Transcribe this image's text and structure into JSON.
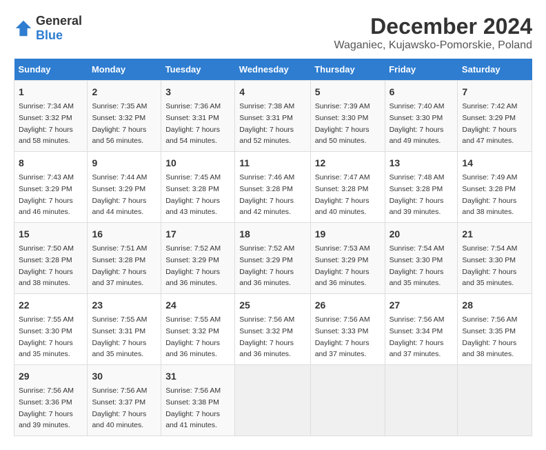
{
  "logo": {
    "general": "General",
    "blue": "Blue"
  },
  "title": "December 2024",
  "subtitle": "Waganiec, Kujawsko-Pomorskie, Poland",
  "days_of_week": [
    "Sunday",
    "Monday",
    "Tuesday",
    "Wednesday",
    "Thursday",
    "Friday",
    "Saturday"
  ],
  "weeks": [
    [
      {
        "day": "1",
        "sunrise": "7:34 AM",
        "sunset": "3:32 PM",
        "daylight": "7 hours and 58 minutes."
      },
      {
        "day": "2",
        "sunrise": "7:35 AM",
        "sunset": "3:32 PM",
        "daylight": "7 hours and 56 minutes."
      },
      {
        "day": "3",
        "sunrise": "7:36 AM",
        "sunset": "3:31 PM",
        "daylight": "7 hours and 54 minutes."
      },
      {
        "day": "4",
        "sunrise": "7:38 AM",
        "sunset": "3:31 PM",
        "daylight": "7 hours and 52 minutes."
      },
      {
        "day": "5",
        "sunrise": "7:39 AM",
        "sunset": "3:30 PM",
        "daylight": "7 hours and 50 minutes."
      },
      {
        "day": "6",
        "sunrise": "7:40 AM",
        "sunset": "3:30 PM",
        "daylight": "7 hours and 49 minutes."
      },
      {
        "day": "7",
        "sunrise": "7:42 AM",
        "sunset": "3:29 PM",
        "daylight": "7 hours and 47 minutes."
      }
    ],
    [
      {
        "day": "8",
        "sunrise": "7:43 AM",
        "sunset": "3:29 PM",
        "daylight": "7 hours and 46 minutes."
      },
      {
        "day": "9",
        "sunrise": "7:44 AM",
        "sunset": "3:29 PM",
        "daylight": "7 hours and 44 minutes."
      },
      {
        "day": "10",
        "sunrise": "7:45 AM",
        "sunset": "3:28 PM",
        "daylight": "7 hours and 43 minutes."
      },
      {
        "day": "11",
        "sunrise": "7:46 AM",
        "sunset": "3:28 PM",
        "daylight": "7 hours and 42 minutes."
      },
      {
        "day": "12",
        "sunrise": "7:47 AM",
        "sunset": "3:28 PM",
        "daylight": "7 hours and 40 minutes."
      },
      {
        "day": "13",
        "sunrise": "7:48 AM",
        "sunset": "3:28 PM",
        "daylight": "7 hours and 39 minutes."
      },
      {
        "day": "14",
        "sunrise": "7:49 AM",
        "sunset": "3:28 PM",
        "daylight": "7 hours and 38 minutes."
      }
    ],
    [
      {
        "day": "15",
        "sunrise": "7:50 AM",
        "sunset": "3:28 PM",
        "daylight": "7 hours and 38 minutes."
      },
      {
        "day": "16",
        "sunrise": "7:51 AM",
        "sunset": "3:28 PM",
        "daylight": "7 hours and 37 minutes."
      },
      {
        "day": "17",
        "sunrise": "7:52 AM",
        "sunset": "3:29 PM",
        "daylight": "7 hours and 36 minutes."
      },
      {
        "day": "18",
        "sunrise": "7:52 AM",
        "sunset": "3:29 PM",
        "daylight": "7 hours and 36 minutes."
      },
      {
        "day": "19",
        "sunrise": "7:53 AM",
        "sunset": "3:29 PM",
        "daylight": "7 hours and 36 minutes."
      },
      {
        "day": "20",
        "sunrise": "7:54 AM",
        "sunset": "3:30 PM",
        "daylight": "7 hours and 35 minutes."
      },
      {
        "day": "21",
        "sunrise": "7:54 AM",
        "sunset": "3:30 PM",
        "daylight": "7 hours and 35 minutes."
      }
    ],
    [
      {
        "day": "22",
        "sunrise": "7:55 AM",
        "sunset": "3:30 PM",
        "daylight": "7 hours and 35 minutes."
      },
      {
        "day": "23",
        "sunrise": "7:55 AM",
        "sunset": "3:31 PM",
        "daylight": "7 hours and 35 minutes."
      },
      {
        "day": "24",
        "sunrise": "7:55 AM",
        "sunset": "3:32 PM",
        "daylight": "7 hours and 36 minutes."
      },
      {
        "day": "25",
        "sunrise": "7:56 AM",
        "sunset": "3:32 PM",
        "daylight": "7 hours and 36 minutes."
      },
      {
        "day": "26",
        "sunrise": "7:56 AM",
        "sunset": "3:33 PM",
        "daylight": "7 hours and 37 minutes."
      },
      {
        "day": "27",
        "sunrise": "7:56 AM",
        "sunset": "3:34 PM",
        "daylight": "7 hours and 37 minutes."
      },
      {
        "day": "28",
        "sunrise": "7:56 AM",
        "sunset": "3:35 PM",
        "daylight": "7 hours and 38 minutes."
      }
    ],
    [
      {
        "day": "29",
        "sunrise": "7:56 AM",
        "sunset": "3:36 PM",
        "daylight": "7 hours and 39 minutes."
      },
      {
        "day": "30",
        "sunrise": "7:56 AM",
        "sunset": "3:37 PM",
        "daylight": "7 hours and 40 minutes."
      },
      {
        "day": "31",
        "sunrise": "7:56 AM",
        "sunset": "3:38 PM",
        "daylight": "7 hours and 41 minutes."
      },
      null,
      null,
      null,
      null
    ]
  ]
}
